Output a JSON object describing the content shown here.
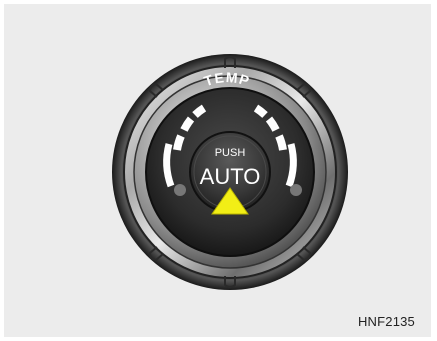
{
  "knob": {
    "ring_label": "TEMP",
    "push_label": "PUSH",
    "button_label": "AUTO",
    "pointer_icon": "up-triangle-icon",
    "colors": {
      "pointer": "#f2ee16",
      "face": "#2e2e2e",
      "label": "#ffffff",
      "indicator_dot": "#777777"
    }
  },
  "figure_code": "HNF2135"
}
